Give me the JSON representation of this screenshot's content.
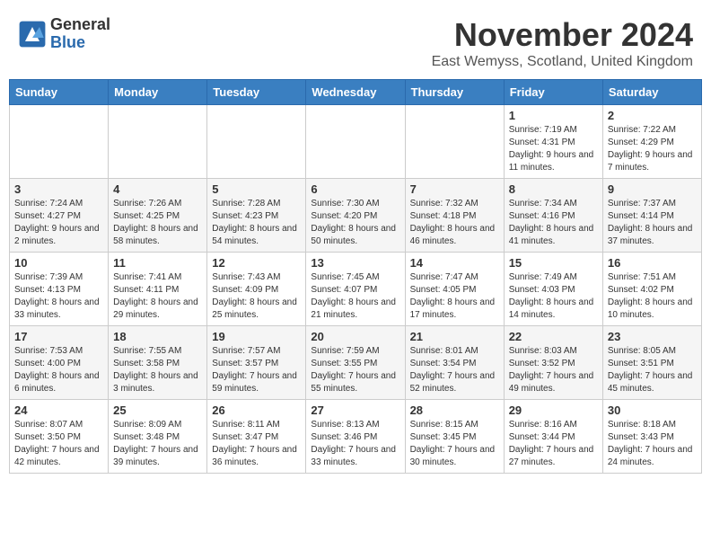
{
  "logo": {
    "general": "General",
    "blue": "Blue"
  },
  "title": "November 2024",
  "location": "East Wemyss, Scotland, United Kingdom",
  "days_of_week": [
    "Sunday",
    "Monday",
    "Tuesday",
    "Wednesday",
    "Thursday",
    "Friday",
    "Saturday"
  ],
  "weeks": [
    [
      {
        "day": "",
        "info": ""
      },
      {
        "day": "",
        "info": ""
      },
      {
        "day": "",
        "info": ""
      },
      {
        "day": "",
        "info": ""
      },
      {
        "day": "",
        "info": ""
      },
      {
        "day": "1",
        "info": "Sunrise: 7:19 AM\nSunset: 4:31 PM\nDaylight: 9 hours and 11 minutes."
      },
      {
        "day": "2",
        "info": "Sunrise: 7:22 AM\nSunset: 4:29 PM\nDaylight: 9 hours and 7 minutes."
      }
    ],
    [
      {
        "day": "3",
        "info": "Sunrise: 7:24 AM\nSunset: 4:27 PM\nDaylight: 9 hours and 2 minutes."
      },
      {
        "day": "4",
        "info": "Sunrise: 7:26 AM\nSunset: 4:25 PM\nDaylight: 8 hours and 58 minutes."
      },
      {
        "day": "5",
        "info": "Sunrise: 7:28 AM\nSunset: 4:23 PM\nDaylight: 8 hours and 54 minutes."
      },
      {
        "day": "6",
        "info": "Sunrise: 7:30 AM\nSunset: 4:20 PM\nDaylight: 8 hours and 50 minutes."
      },
      {
        "day": "7",
        "info": "Sunrise: 7:32 AM\nSunset: 4:18 PM\nDaylight: 8 hours and 46 minutes."
      },
      {
        "day": "8",
        "info": "Sunrise: 7:34 AM\nSunset: 4:16 PM\nDaylight: 8 hours and 41 minutes."
      },
      {
        "day": "9",
        "info": "Sunrise: 7:37 AM\nSunset: 4:14 PM\nDaylight: 8 hours and 37 minutes."
      }
    ],
    [
      {
        "day": "10",
        "info": "Sunrise: 7:39 AM\nSunset: 4:13 PM\nDaylight: 8 hours and 33 minutes."
      },
      {
        "day": "11",
        "info": "Sunrise: 7:41 AM\nSunset: 4:11 PM\nDaylight: 8 hours and 29 minutes."
      },
      {
        "day": "12",
        "info": "Sunrise: 7:43 AM\nSunset: 4:09 PM\nDaylight: 8 hours and 25 minutes."
      },
      {
        "day": "13",
        "info": "Sunrise: 7:45 AM\nSunset: 4:07 PM\nDaylight: 8 hours and 21 minutes."
      },
      {
        "day": "14",
        "info": "Sunrise: 7:47 AM\nSunset: 4:05 PM\nDaylight: 8 hours and 17 minutes."
      },
      {
        "day": "15",
        "info": "Sunrise: 7:49 AM\nSunset: 4:03 PM\nDaylight: 8 hours and 14 minutes."
      },
      {
        "day": "16",
        "info": "Sunrise: 7:51 AM\nSunset: 4:02 PM\nDaylight: 8 hours and 10 minutes."
      }
    ],
    [
      {
        "day": "17",
        "info": "Sunrise: 7:53 AM\nSunset: 4:00 PM\nDaylight: 8 hours and 6 minutes."
      },
      {
        "day": "18",
        "info": "Sunrise: 7:55 AM\nSunset: 3:58 PM\nDaylight: 8 hours and 3 minutes."
      },
      {
        "day": "19",
        "info": "Sunrise: 7:57 AM\nSunset: 3:57 PM\nDaylight: 7 hours and 59 minutes."
      },
      {
        "day": "20",
        "info": "Sunrise: 7:59 AM\nSunset: 3:55 PM\nDaylight: 7 hours and 55 minutes."
      },
      {
        "day": "21",
        "info": "Sunrise: 8:01 AM\nSunset: 3:54 PM\nDaylight: 7 hours and 52 minutes."
      },
      {
        "day": "22",
        "info": "Sunrise: 8:03 AM\nSunset: 3:52 PM\nDaylight: 7 hours and 49 minutes."
      },
      {
        "day": "23",
        "info": "Sunrise: 8:05 AM\nSunset: 3:51 PM\nDaylight: 7 hours and 45 minutes."
      }
    ],
    [
      {
        "day": "24",
        "info": "Sunrise: 8:07 AM\nSunset: 3:50 PM\nDaylight: 7 hours and 42 minutes."
      },
      {
        "day": "25",
        "info": "Sunrise: 8:09 AM\nSunset: 3:48 PM\nDaylight: 7 hours and 39 minutes."
      },
      {
        "day": "26",
        "info": "Sunrise: 8:11 AM\nSunset: 3:47 PM\nDaylight: 7 hours and 36 minutes."
      },
      {
        "day": "27",
        "info": "Sunrise: 8:13 AM\nSunset: 3:46 PM\nDaylight: 7 hours and 33 minutes."
      },
      {
        "day": "28",
        "info": "Sunrise: 8:15 AM\nSunset: 3:45 PM\nDaylight: 7 hours and 30 minutes."
      },
      {
        "day": "29",
        "info": "Sunrise: 8:16 AM\nSunset: 3:44 PM\nDaylight: 7 hours and 27 minutes."
      },
      {
        "day": "30",
        "info": "Sunrise: 8:18 AM\nSunset: 3:43 PM\nDaylight: 7 hours and 24 minutes."
      }
    ]
  ]
}
